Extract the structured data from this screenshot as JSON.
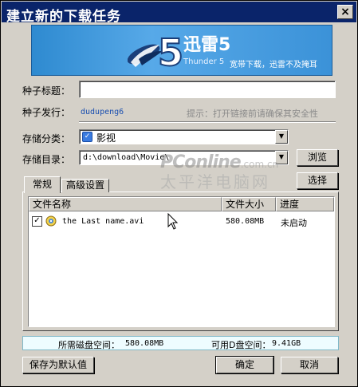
{
  "window": {
    "title": "建立新的下载任务",
    "close_symbol": "×"
  },
  "banner": {
    "logo_digit": "5",
    "product_name": "迅雷5",
    "product_en": "Thunder 5",
    "slogan": "宽带下载，迅雷不及掩耳",
    "colors": {
      "background": "#3b92d8",
      "text": "#ffffff"
    }
  },
  "form": {
    "torrent_title_label": "种子标题：",
    "torrent_title_value": "",
    "publisher_label": "种子发行：",
    "publisher_value": "dudupeng6",
    "hint": "提示：打开链接前请确保其安全性",
    "category_label": "存储分类：",
    "category_value": "影视",
    "category_icon": "check-badge-icon",
    "directory_label": "存储目录：",
    "directory_value": "d:\\download\\Movie\\",
    "browse_button": "浏览",
    "select_button": "选择"
  },
  "tabs": [
    {
      "label": "常规",
      "active": true
    },
    {
      "label": "高级设置",
      "active": false
    }
  ],
  "file_list": {
    "columns": [
      "文件名称",
      "文件大小",
      "进度"
    ],
    "rows": [
      {
        "checked": true,
        "icon": "video-file-icon",
        "name": "the Last name.avi",
        "size": "580.08MB",
        "status": "未启动"
      }
    ]
  },
  "status": {
    "required_label": "所需磁盘空间：",
    "required_value": "580.08MB",
    "available_label": "可用D盘空间：",
    "available_value": "9.41GB"
  },
  "buttons": {
    "save_default": "保存为默认值",
    "ok": "确定",
    "cancel": "取消"
  },
  "watermark": {
    "brand": "PConline",
    "domain": ".com.cn",
    "chinese": "太平洋电脑网"
  }
}
